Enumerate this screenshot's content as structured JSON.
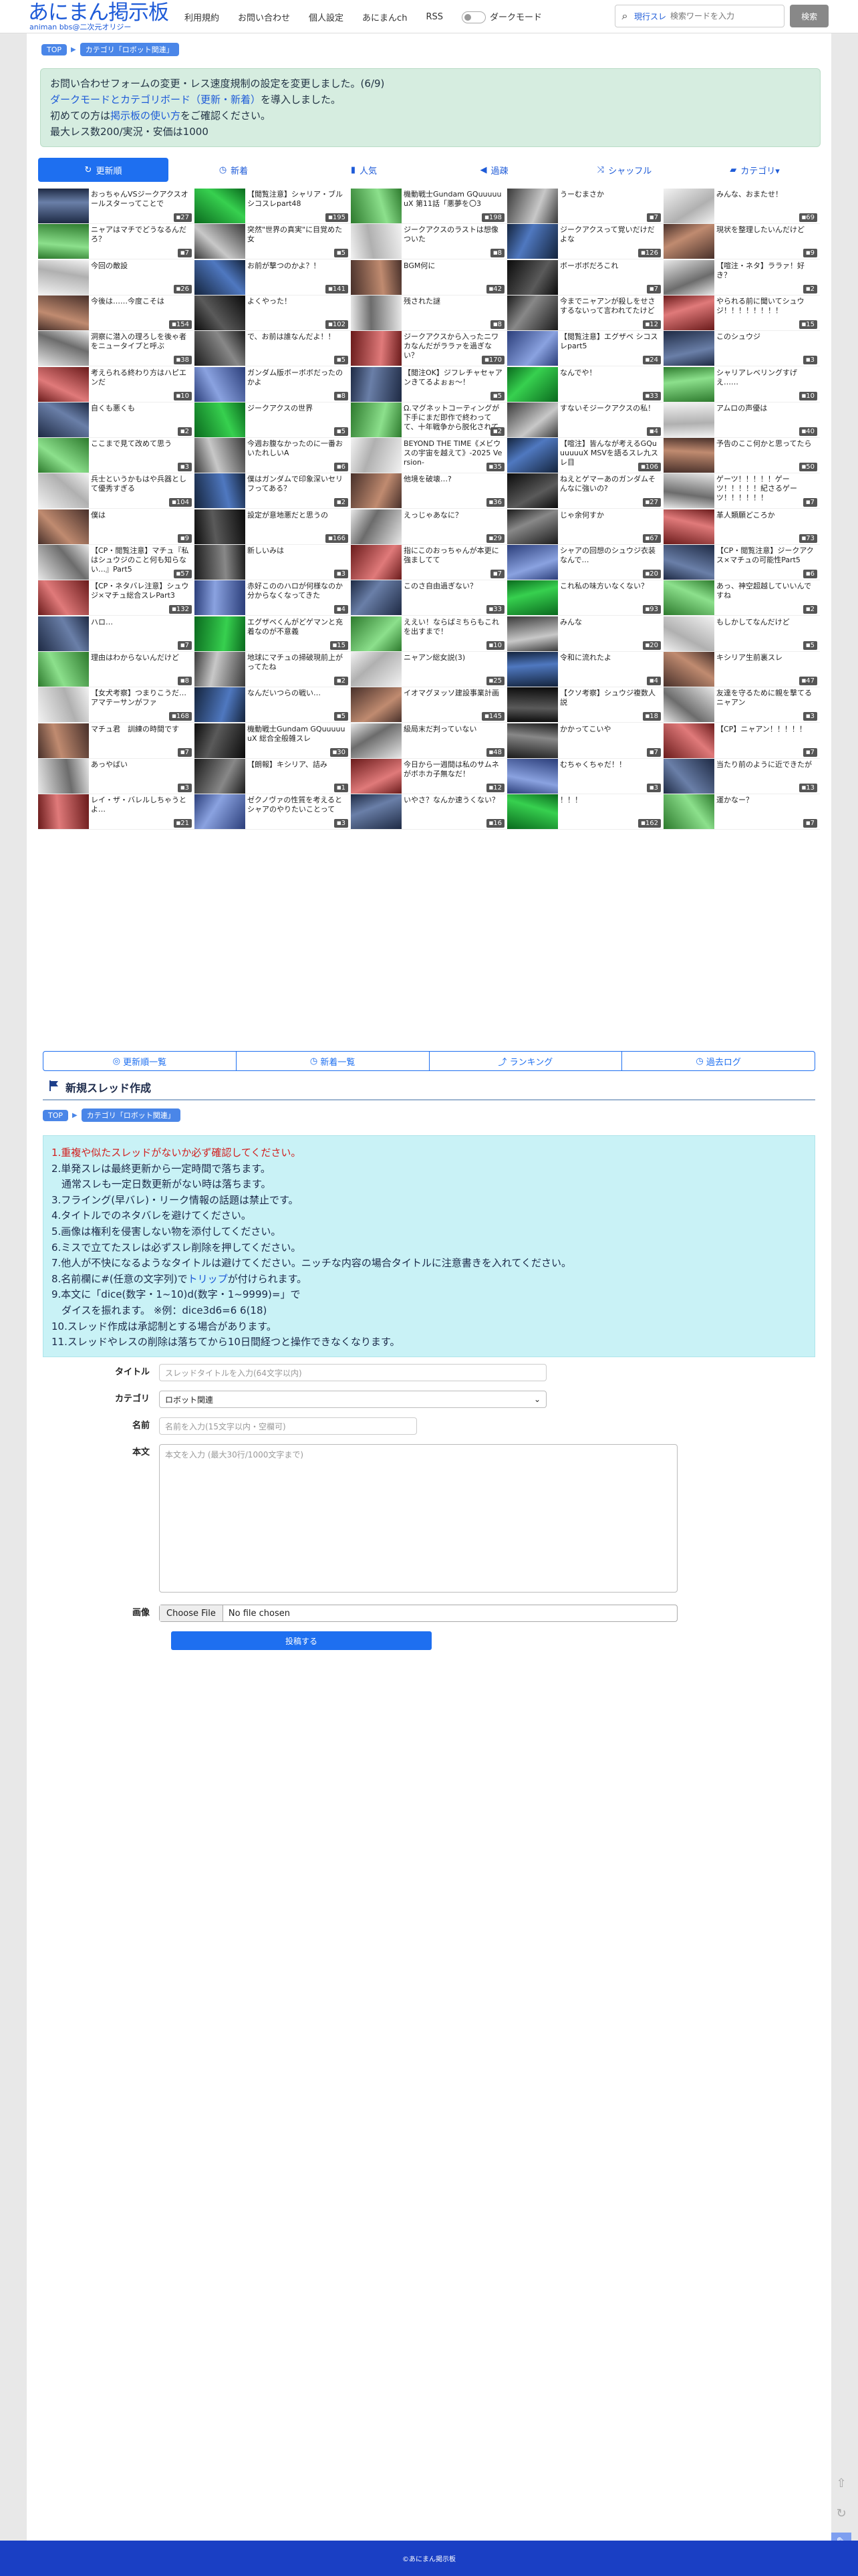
{
  "header": {
    "logo_main": "あにまん掲示板",
    "logo_sub": "animan bbs@二次元オリジー",
    "nav": [
      "利用規約",
      "お問い合わせ",
      "個人設定",
      "あにまんch",
      "RSS"
    ],
    "dark_mode": "ダークモード",
    "search_scope": "現行スレ",
    "search_placeholder": "検索ワードを入力",
    "search_button": "検索"
  },
  "breadcrumb": {
    "top": "TOP",
    "category": "カテゴリ「ロボット関連」"
  },
  "notice": {
    "line1": "お問い合わせフォームの変更・レス速度規制の設定を変更しました。(6/9)",
    "line2_link": "ダークモードとカテゴリボード（更新・新着）",
    "line2_rest": "を導入しました。",
    "line3_pre": "初めての方は",
    "line3_link": "掲示板の使い方",
    "line3_post": "をご確認ください。",
    "line4": "最大レス数200/実況・安価は1000"
  },
  "tabs": [
    {
      "icon": "↻",
      "label": "更新順"
    },
    {
      "icon": "◷",
      "label": "新着"
    },
    {
      "icon": "▮",
      "label": "人気"
    },
    {
      "icon": "◀",
      "label": "過疎"
    },
    {
      "icon": "⤨",
      "label": "シャッフル"
    },
    {
      "icon": "▰",
      "label": "カテゴリ▾"
    }
  ],
  "threads": [
    {
      "t": "おっちゃんVSジークアクスオールスターってことで",
      "c": "27"
    },
    {
      "t": "【閲覧注意】シャリア・ブル シコスレpart48",
      "c": "195"
    },
    {
      "t": "機動戦士Gundam GQuuuuuuX 第11話「悪夢を〇3",
      "c": "198"
    },
    {
      "t": "うーむまさか",
      "c": "7"
    },
    {
      "t": "みんな、おまたせ！",
      "c": "69"
    },
    {
      "t": "ニャアはマチでどうなるんだろ？",
      "c": "7"
    },
    {
      "t": "突然\"世界の真実\"に目覚めた女",
      "c": "5"
    },
    {
      "t": "ジークアクスのラストは想像ついた",
      "c": "8"
    },
    {
      "t": "ジークアクスって覚いだけだよな",
      "c": "126"
    },
    {
      "t": "現状を整理したいんだけど",
      "c": "9"
    },
    {
      "t": "今回の敵設",
      "c": "26"
    },
    {
      "t": "お前が撃つのかよ？！",
      "c": "141"
    },
    {
      "t": "BGM何に",
      "c": "42"
    },
    {
      "t": "ボーボボだろこれ",
      "c": "7"
    },
    {
      "t": "【喧注・ネタ】ララァ！好き？",
      "c": "2"
    },
    {
      "t": "今後は……今度こそは",
      "c": "154"
    },
    {
      "t": "よくやった！",
      "c": "102"
    },
    {
      "t": "残された謎",
      "c": "8"
    },
    {
      "t": "今までニャアンが殺しをせさするないって言われてたけど",
      "c": "12"
    },
    {
      "t": "やられる前に聞いてシュウジ！！！！！！！！",
      "c": "15"
    },
    {
      "t": "洞察に潜入の理ろしを後ゃ者をニュータイプと呼ぶ",
      "c": "38"
    },
    {
      "t": "で、お前は誰なんだよ！！",
      "c": "5"
    },
    {
      "t": "ジークアクスから入ったニワカなんだがララァを過ぎない？",
      "c": "170"
    },
    {
      "t": "【閲覧注意】エグザベ シコスレpart5",
      "c": "24"
    },
    {
      "t": "このシュウジ",
      "c": "3"
    },
    {
      "t": "考えられる終わり方はハピエンだ",
      "c": "10"
    },
    {
      "t": "ガンダム版ボーボボだったのかよ",
      "c": "8"
    },
    {
      "t": "【閲注OK】ジフレチャセャアンきてるよぉぉ～！",
      "c": "5"
    },
    {
      "t": "なんでや！",
      "c": "33"
    },
    {
      "t": "シャリアレベリングすげえ……",
      "c": "10"
    },
    {
      "t": "自くも悪くも",
      "c": "2"
    },
    {
      "t": "ジークアクスの世界",
      "c": "5"
    },
    {
      "t": "Ω.マグネットコーティングが下手にまだ即作で終わってて、十年戦争から脱化されてない恐いなわンダムも死を迎えた理由",
      "c": "2"
    },
    {
      "t": "すないそジークアクスの私！",
      "c": "4"
    },
    {
      "t": "アムロの声優は",
      "c": "40"
    },
    {
      "t": "ここまで見て改めて思う",
      "c": "3"
    },
    {
      "t": "今週お腹なかったのに一番おいたれしいA",
      "c": "6"
    },
    {
      "t": "BEYOND THE TIME《メビウスの宇宙を越えて》-2025 Version-",
      "c": "35"
    },
    {
      "t": "【喧注】皆んなが考えるGQuuuuuuX MSVを語るスレ九スレ目",
      "c": "106"
    },
    {
      "t": "予告のここ何かと思ってたら",
      "c": "50"
    },
    {
      "t": "兵士というかもはや兵器として優秀すぎる",
      "c": "104"
    },
    {
      "t": "僕はガンダムで印象深いセリフってある？",
      "c": "2"
    },
    {
      "t": "他境を破壊…?",
      "c": "36"
    },
    {
      "t": "ねえとゲマーあのガンダムそんなに強いの?",
      "c": "27"
    },
    {
      "t": "ゲーツ！！！！！ゲーツ！！！！！紀さるゲーツ！！！！！！",
      "c": "7"
    },
    {
      "t": "僕は",
      "c": "9"
    },
    {
      "t": "設定が意地悪だと思うの",
      "c": "166"
    },
    {
      "t": "えっじゃあなに？",
      "c": "29"
    },
    {
      "t": "じゃ余何すか",
      "c": "67"
    },
    {
      "t": "革人類願どころか",
      "c": "73"
    },
    {
      "t": "【CP・閲覧注意】マチュ『私はシュウジのこと何も知らない…』Part5",
      "c": "57"
    },
    {
      "t": "新しいみは",
      "c": "3"
    },
    {
      "t": "指にこのおっちゃんが本更に強ましてて",
      "c": "7"
    },
    {
      "t": "シャアの回想のシュウジ衣装なんで…",
      "c": "20"
    },
    {
      "t": "【CP・閲覧注意】ジークアクス×マチュの可能性Part5",
      "c": "6"
    },
    {
      "t": "【CP・ネタバレ注意】シュウジ×マチュ総合スレPart3",
      "c": "132"
    },
    {
      "t": "赤好こののハロが何様なのか分からなくなってきた",
      "c": "4"
    },
    {
      "t": "このさ自由過ぎない？",
      "c": "33"
    },
    {
      "t": "これ私の味方いなくない？",
      "c": "93"
    },
    {
      "t": "あっ、神空超越していいんですね",
      "c": "2"
    },
    {
      "t": "ハロ…",
      "c": "7"
    },
    {
      "t": "エグザベくんがどゲマンと充着なのが不意義",
      "c": "15"
    },
    {
      "t": "ええい！ならばミちらもこれを出すまで！",
      "c": "10"
    },
    {
      "t": "みんな",
      "c": "20"
    },
    {
      "t": "もしかしてなんだけど",
      "c": "5"
    },
    {
      "t": "理由はわからないんだけど",
      "c": "8"
    },
    {
      "t": "地球にマチュの掃破現前上がってたね",
      "c": "2"
    },
    {
      "t": "ニャアン総女説(3)",
      "c": "25"
    },
    {
      "t": "令和に流れたよ",
      "c": "4"
    },
    {
      "t": "キシリア生前裏スレ",
      "c": "47"
    },
    {
      "t": "【女犬考察】つまりこうだ…アマテーサンがファ",
      "c": "168"
    },
    {
      "t": "なんだいつらの戦い…",
      "c": "5"
    },
    {
      "t": "イオマグヌッソ建設事業計画",
      "c": "145"
    },
    {
      "t": "【クソ考察】シュウジ複数人説",
      "c": "18"
    },
    {
      "t": "友達を守るために親を撃てるニャアン",
      "c": "3"
    },
    {
      "t": "マチュ君　訓練の時間です",
      "c": "7"
    },
    {
      "t": "機動戦士Gundam GQuuuuuuX 総合全般雑スレ",
      "c": "30"
    },
    {
      "t": "級局末だ判っていない",
      "c": "48"
    },
    {
      "t": "かかってこいや",
      "c": "7"
    },
    {
      "t": "【CP】ニャアン！！！！！",
      "c": "7"
    },
    {
      "t": "あっやばい",
      "c": "3"
    },
    {
      "t": "【朗報】キシリア、詰み",
      "c": "1"
    },
    {
      "t": "今日から一週間は私のサムネがボホカ子無なだ！",
      "c": "12"
    },
    {
      "t": "むちゃくちゃだ！！",
      "c": "3"
    },
    {
      "t": "当たり前のように近できたが",
      "c": "13"
    },
    {
      "t": "レイ・ザ・バレルしちゃうとよ…",
      "c": "21"
    },
    {
      "t": "ゼクノヴァの性質を考えるとシャアのやりたいことって",
      "c": "3"
    },
    {
      "t": "いやさ？なんか速うくない？",
      "c": "16"
    },
    {
      "t": "！！！",
      "c": "162"
    },
    {
      "t": "運かなー？",
      "c": "7"
    }
  ],
  "bottom_nav": [
    {
      "icon": "◎",
      "label": "更新順一覧"
    },
    {
      "icon": "◷",
      "label": "新着一覧"
    },
    {
      "icon": "⤴",
      "label": "ランキング"
    },
    {
      "icon": "◷",
      "label": "過去ログ"
    }
  ],
  "new_thread": {
    "title": "新規スレッド作成"
  },
  "rules": {
    "r1": "1.重複や似たスレッドがないか必ず確認してください。",
    "r2": "2.単発スレは最終更新から一定時間で落ちます。",
    "r2b": "　通常スレも一定日数更新がない時は落ちます。",
    "r3": "3.フライング(早バレ)・リーク情報の話題は禁止です。",
    "r4": "4.タイトルでのネタバレを避けてください。",
    "r5": "5.画像は権利を侵害しない物を添付してください。",
    "r6": "6.ミスで立てたスレは必ずスレ削除を押してください。",
    "r7": "7.他人が不快になるようなタイトルは避けてください。ニッチな内容の場合タイトルに注意書きを入れてください。",
    "r8_pre": "8.名前欄に#(任意の文字列)で",
    "r8_link": "トリップ",
    "r8_post": "が付けられます。",
    "r9": "9.本文に「dice(数字・1~10)d(数字・1~9999)=」で",
    "r9b": "　ダイスを振れます。 ※例：dice3d6=6 6(18)",
    "r10": "10.スレッド作成は承認制とする場合があります。",
    "r11": "11.スレッドやレスの削除は落ちてから10日間経つと操作できなくなります。"
  },
  "form": {
    "title_label": "タイトル",
    "title_placeholder": "スレッドタイトルを入力(64文字以内)",
    "category_label": "カテゴリ",
    "category_value": "ロボット関連",
    "name_label": "名前",
    "name_placeholder": "名前を入力(15文字以内・空欄可)",
    "body_label": "本文",
    "body_placeholder": "本文を入力 (最大30行/1000文字まで)",
    "image_label": "画像",
    "choose_file": "Choose File",
    "no_file": "No file chosen",
    "submit": "投稿する"
  },
  "footer": "©あにまん掲示板"
}
